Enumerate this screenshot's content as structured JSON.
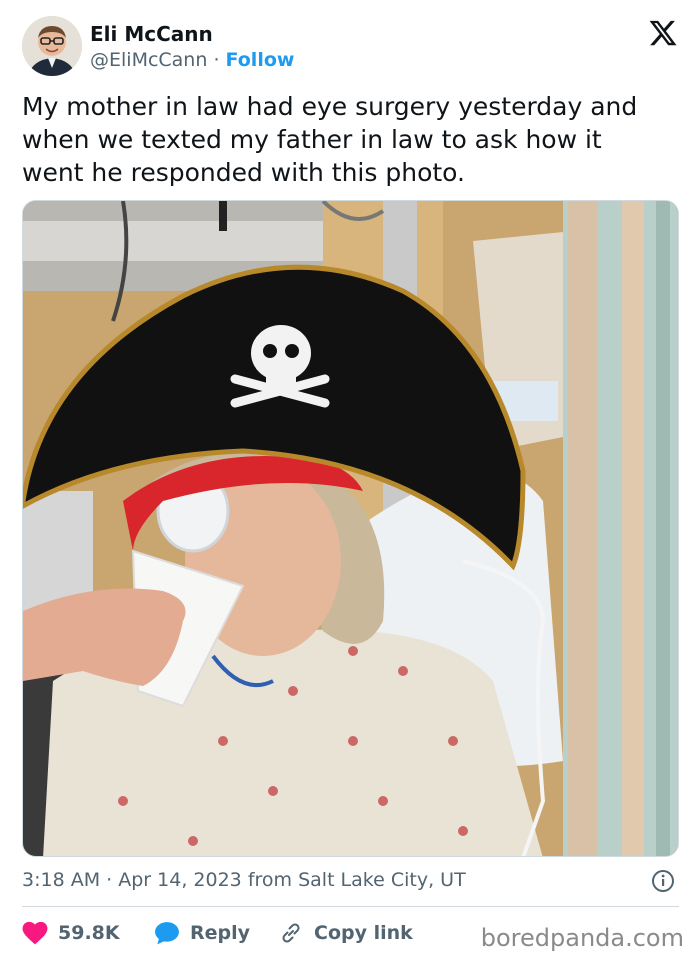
{
  "author": {
    "name": "Eli McCann",
    "handle": "@EliMcCann",
    "separator": "·",
    "follow_label": "Follow",
    "avatar_icon": "profile-photo"
  },
  "platform_icon": "x-logo",
  "tweet": {
    "text_lines": [
      "My mother in law had eye surgery yesterday and",
      "when we texted my father in law to ask how it",
      "went he responded with this photo."
    ]
  },
  "photo": {
    "description_icon": "hospital-pirate-hat-photo"
  },
  "meta": {
    "time": "3:18 AM",
    "separator": "·",
    "date": "Apr 14, 2023",
    "location": "from Salt Lake City, UT",
    "info_icon": "info-icon"
  },
  "actions": {
    "likes": "59.8K",
    "reply_label": "Reply",
    "copy_link_label": "Copy link"
  },
  "watermark": "boredpanda.com",
  "colors": {
    "accent": "#1d9bf0",
    "heart": "#f91880",
    "muted": "#536471",
    "text": "#0f1419"
  }
}
